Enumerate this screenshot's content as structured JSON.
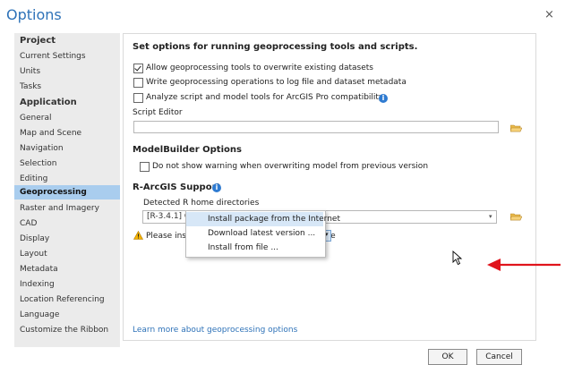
{
  "dialog": {
    "title": "Options",
    "close_glyph": "×"
  },
  "sidebar": {
    "groups": [
      {
        "header": "Project",
        "items": [
          "Current Settings",
          "Units",
          "Tasks"
        ]
      },
      {
        "header": "Application",
        "items": [
          "General",
          "Map and Scene",
          "Navigation",
          "Selection",
          "Editing",
          "Geoprocessing",
          "Raster and Imagery",
          "CAD",
          "Display",
          "Layout",
          "Metadata",
          "Indexing",
          "Location Referencing",
          "Language",
          "Customize the Ribbon"
        ]
      }
    ],
    "selected": "Geoprocessing"
  },
  "main": {
    "heading": "Set options for running geoprocessing tools and scripts.",
    "options": [
      {
        "label": "Allow geoprocessing tools to overwrite existing datasets",
        "checked": true
      },
      {
        "label": "Write geoprocessing operations to log file and dataset metadata",
        "checked": false
      },
      {
        "label": "Analyze script and model tools for ArcGIS Pro compatibility",
        "checked": false
      }
    ],
    "script_editor_label": "Script Editor",
    "script_editor_value": "",
    "modelbuilder": {
      "title": "ModelBuilder Options",
      "option": {
        "label": "Do not show warning when overwriting model from previous version",
        "checked": false
      }
    },
    "r_support": {
      "title": "R-ArcGIS Support",
      "detected_label": "Detected R home directories",
      "detected_value": "[R-3.4.1] C:\\Program Files\\R\\R-3.4.1",
      "warning": "Please install the ArcGIS R integration package"
    },
    "menu": {
      "items": [
        "Install package from the Internet",
        "Download latest version ...",
        "Install from file ..."
      ],
      "highlighted": 0
    },
    "learn_more": "Learn more about geoprocessing options"
  },
  "footer": {
    "ok": "OK",
    "cancel": "Cancel"
  },
  "colors": {
    "accent": "#2e72b8",
    "selection": "#a9cdee",
    "annotation_arrow": "#e0141c"
  }
}
